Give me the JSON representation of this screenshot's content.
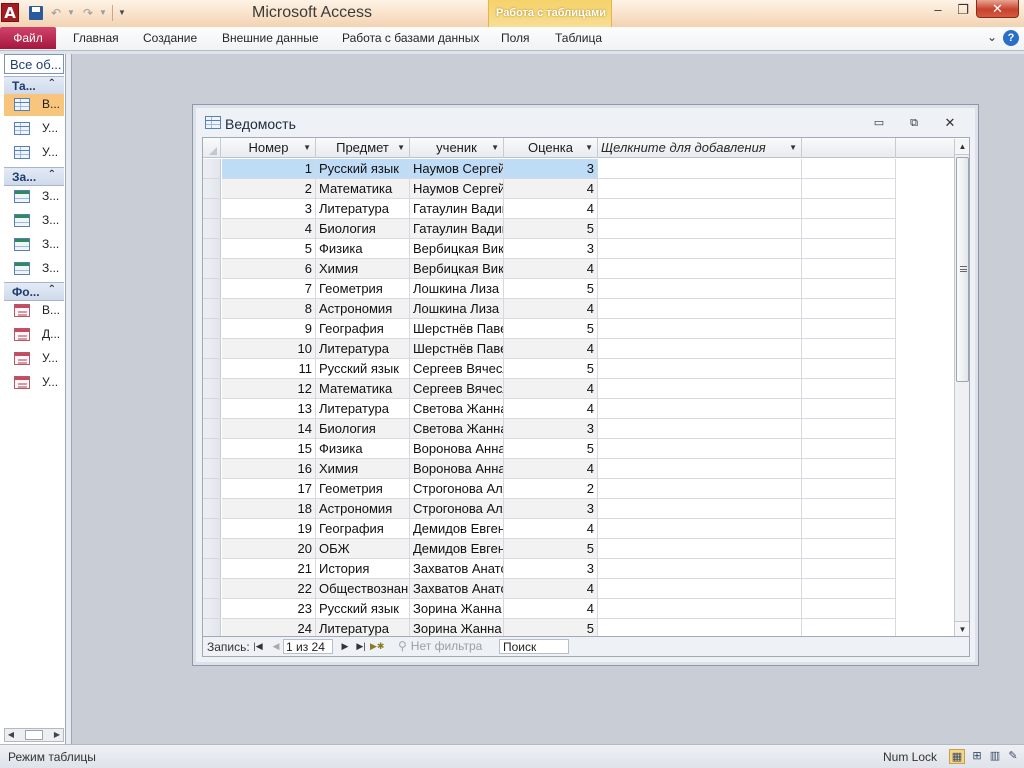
{
  "app": {
    "icon_letter": "A",
    "window_title": "Microsoft Access",
    "context_tab_group": "Работа с таблицами"
  },
  "quick_access": {
    "save_icon": "save-icon",
    "undo_icon": "undo-icon",
    "redo_icon": "redo-icon"
  },
  "window_controls": {
    "minimize": "–",
    "maximize": "❐",
    "close": "✕"
  },
  "ribbon": {
    "file": "Файл",
    "tabs": [
      "Главная",
      "Создание",
      "Внешние данные",
      "Работа с базами данных",
      "Поля",
      "Таблица"
    ],
    "expand_glyph": "⌄",
    "help_glyph": "?"
  },
  "nav_pane": {
    "header": "Все об...",
    "groups": [
      {
        "label": "Та...",
        "items": [
          "В...",
          "У...",
          "У..."
        ]
      },
      {
        "label": "За...",
        "items": [
          "З...",
          "З...",
          "З...",
          "З..."
        ]
      },
      {
        "label": "Фо...",
        "items": [
          "В...",
          "Д...",
          "У...",
          "У..."
        ]
      }
    ],
    "selected_item": "В..."
  },
  "child_window": {
    "title": "Ведомость",
    "controls": {
      "minimize": "▭",
      "restore": "⧉",
      "close": "✕"
    }
  },
  "datasheet": {
    "columns": [
      "Номер",
      "Предмет",
      "ученик",
      "Оценка",
      "Щелкните для добавления"
    ],
    "rows": [
      [
        "1",
        "Русский язык",
        "Наумов Сергей",
        "3"
      ],
      [
        "2",
        "Математика",
        "Наумов Сергей",
        "4"
      ],
      [
        "3",
        "Литература",
        "Гатаулин Вадим",
        "4"
      ],
      [
        "4",
        "Биология",
        "Гатаулин Вадим",
        "5"
      ],
      [
        "5",
        "Физика",
        "Вербицкая Вика",
        "3"
      ],
      [
        "6",
        "Химия",
        "Вербицкая Вика",
        "4"
      ],
      [
        "7",
        "Геометрия",
        "Лошкина Лиза",
        "5"
      ],
      [
        "8",
        "Астрономия",
        "Лошкина Лиза",
        "4"
      ],
      [
        "9",
        "География",
        "Шерстнёв Павел",
        "5"
      ],
      [
        "10",
        "Литература",
        "Шерстнёв Павел",
        "4"
      ],
      [
        "11",
        "Русский язык",
        "Сергеев Вячеслав",
        "5"
      ],
      [
        "12",
        "Математика",
        "Сергеев Вячеслав",
        "4"
      ],
      [
        "13",
        "Литература",
        "Светова Жанна",
        "4"
      ],
      [
        "14",
        "Биология",
        "Светова Жанна",
        "3"
      ],
      [
        "15",
        "Физика",
        "Воронова Анна",
        "5"
      ],
      [
        "16",
        "Химия",
        "Воронова Анна",
        "4"
      ],
      [
        "17",
        "Геометрия",
        "Строгонова Алла",
        "2"
      ],
      [
        "18",
        "Астрономия",
        "Строгонова Алла",
        "3"
      ],
      [
        "19",
        "География",
        "Демидов Евгений",
        "4"
      ],
      [
        "20",
        "ОБЖ",
        "Демидов Евгений",
        "5"
      ],
      [
        "21",
        "История",
        "Захватов Анатолий",
        "3"
      ],
      [
        "22",
        "Обществознание",
        "Захватов Анатолий",
        "4"
      ],
      [
        "23",
        "Русский язык",
        "Зорина Жанна",
        "4"
      ],
      [
        "24",
        "Литература",
        "Зорина Жанна",
        "5"
      ]
    ],
    "current_row": 1
  },
  "record_nav": {
    "label": "Запись:",
    "position": "1 из 24",
    "filter": "Нет фильтра",
    "search": "Поиск"
  },
  "status_bar": {
    "mode": "Режим таблицы",
    "numlock": "Num Lock"
  }
}
